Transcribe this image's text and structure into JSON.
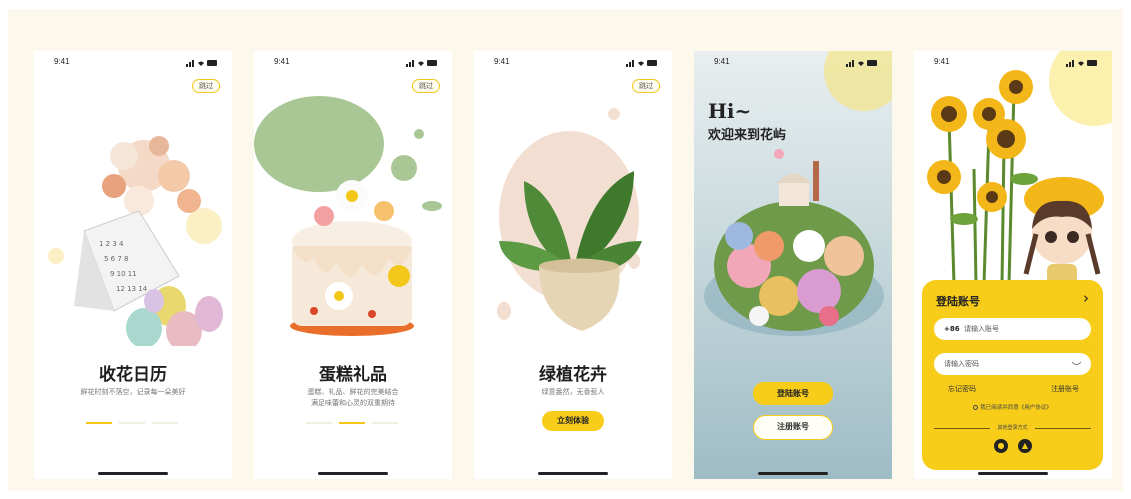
{
  "status": {
    "time": "9:41"
  },
  "screens": [
    {
      "skip": "跳过",
      "title": "收花日历",
      "subtitle": [
        "鲜花时刻不落空，记录每一朵美好"
      ],
      "active_dot": 0
    },
    {
      "skip": "跳过",
      "title": "蛋糕礼品",
      "subtitle": [
        "蛋糕、礼品、鲜花的完美结合",
        "满足味蕾和心灵的双重期待"
      ],
      "active_dot": 1
    },
    {
      "skip": "跳过",
      "title": "绿植花卉",
      "subtitle": [
        "绿意盎然，无香惹人"
      ],
      "button": "立刻体验"
    },
    {
      "greeting": "Hi~",
      "welcome": "欢迎来到花屿",
      "login_button": "登陆账号",
      "register_button": "注册账号"
    },
    {
      "card_title": "登陆账号",
      "phone_prefix": "+86",
      "phone_placeholder": "请输入账号",
      "password_placeholder": "请输入密码",
      "forgot": "忘记密码",
      "register": "注册账号",
      "agreement": "我已阅读并同意《用户协议》",
      "other_login": "其他登录方式"
    }
  ],
  "colors": {
    "accent": "#f7cd1a",
    "canvas": "#fdf8ec"
  }
}
